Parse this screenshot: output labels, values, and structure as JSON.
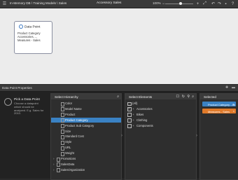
{
  "topbar": {
    "breadcrumb": "In-Memory DB \\ Training Models \\ Sales",
    "title": "Accessory Sales",
    "zoom": "100%",
    "zoom_value_pct": 100
  },
  "card": {
    "title": "Data Point",
    "text": "Product Category Accessories, ... Measures - Sales"
  },
  "panel": {
    "title": "Data Point Properties",
    "pick_title": "Pick a Data Point",
    "pick_desc": "Choose a datapoint which should be analyzed. E.g. Sales for 2010."
  },
  "hierarchy": {
    "title": "Select Hierarchy",
    "items": [
      {
        "label": "Color",
        "selected": false
      },
      {
        "label": "Model Name",
        "selected": false
      },
      {
        "label": "Product",
        "selected": false
      },
      {
        "label": "Product Category",
        "selected": true
      },
      {
        "label": "Product Sub Category",
        "selected": false
      },
      {
        "label": "Size",
        "selected": false
      },
      {
        "label": "Standard Cost",
        "selected": false
      },
      {
        "label": "Style",
        "selected": false
      },
      {
        "label": "URL",
        "selected": false
      },
      {
        "label": "Weight",
        "selected": false
      }
    ],
    "groups": [
      "Promotions",
      "SalesData",
      "SalesOrganization"
    ]
  },
  "elements": {
    "title": "Select Elements",
    "items": [
      {
        "label": "(All)",
        "checked": false,
        "expandable": false
      },
      {
        "label": "Accessories",
        "checked": true,
        "expandable": true
      },
      {
        "label": "Bikes",
        "checked": false,
        "expandable": true
      },
      {
        "label": "Clothing",
        "checked": false,
        "expandable": true
      },
      {
        "label": "Components",
        "checked": false,
        "expandable": true
      }
    ]
  },
  "selected": {
    "title": "Selected",
    "chips": [
      {
        "label": "Product Category - Ac",
        "color": "#3a82c4"
      },
      {
        "label": "Measures - Sales",
        "color": "#e07a2a"
      }
    ]
  },
  "colors": {
    "accent": "#3a82c4",
    "orange": "#e07a2a"
  }
}
